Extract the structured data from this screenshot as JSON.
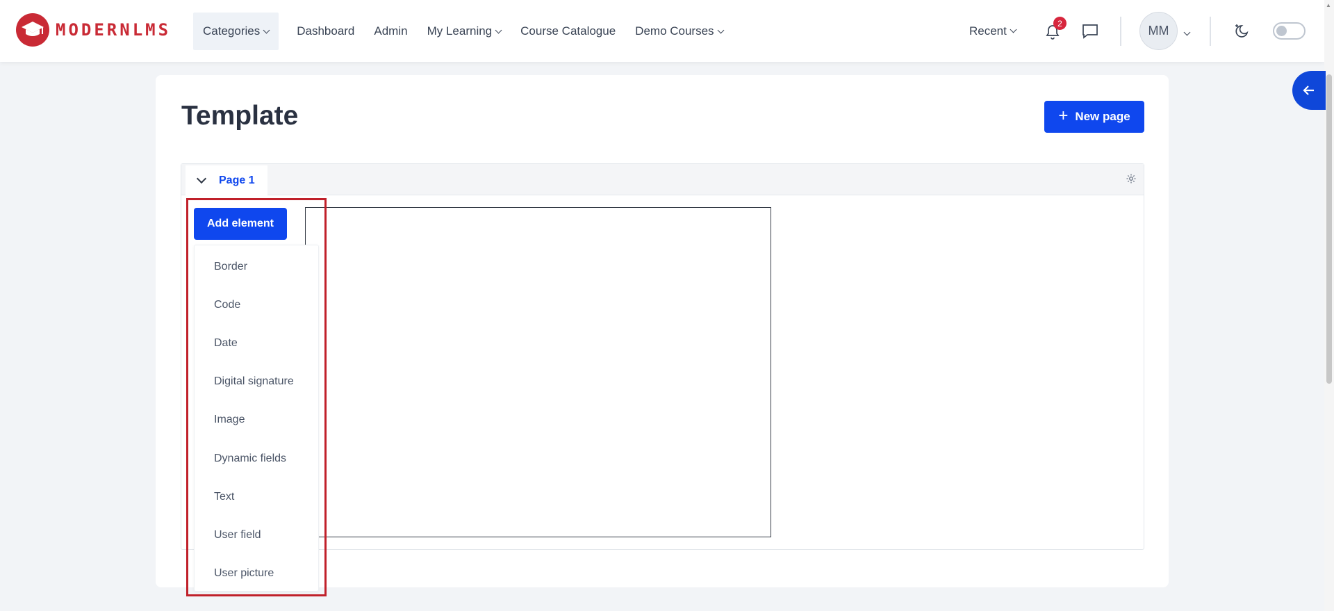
{
  "brand": {
    "name": "MODERNLMS",
    "logo_icon": "graduation-cap-icon",
    "color": "#c92a35"
  },
  "nav": {
    "items": [
      {
        "label": "Categories",
        "has_caret": true,
        "active": true
      },
      {
        "label": "Dashboard",
        "has_caret": false
      },
      {
        "label": "Admin",
        "has_caret": false
      },
      {
        "label": "My Learning",
        "has_caret": true
      },
      {
        "label": "Course Catalogue",
        "has_caret": false
      },
      {
        "label": "Demo Courses",
        "has_caret": true
      }
    ],
    "recent_label": "Recent",
    "notification_count": "2",
    "avatar_initials": "MM"
  },
  "main": {
    "title": "Template",
    "new_page_label": "New page",
    "page_tab_label": "Page 1",
    "add_element_label": "Add element",
    "element_options": [
      "Border",
      "Code",
      "Date",
      "Digital signature",
      "Image",
      "Dynamic fields",
      "Text",
      "User field",
      "User picture"
    ]
  },
  "colors": {
    "primary": "#0f47ee",
    "highlight": "#c0202a",
    "badge": "#d7263d",
    "background": "#f2f4f7"
  }
}
